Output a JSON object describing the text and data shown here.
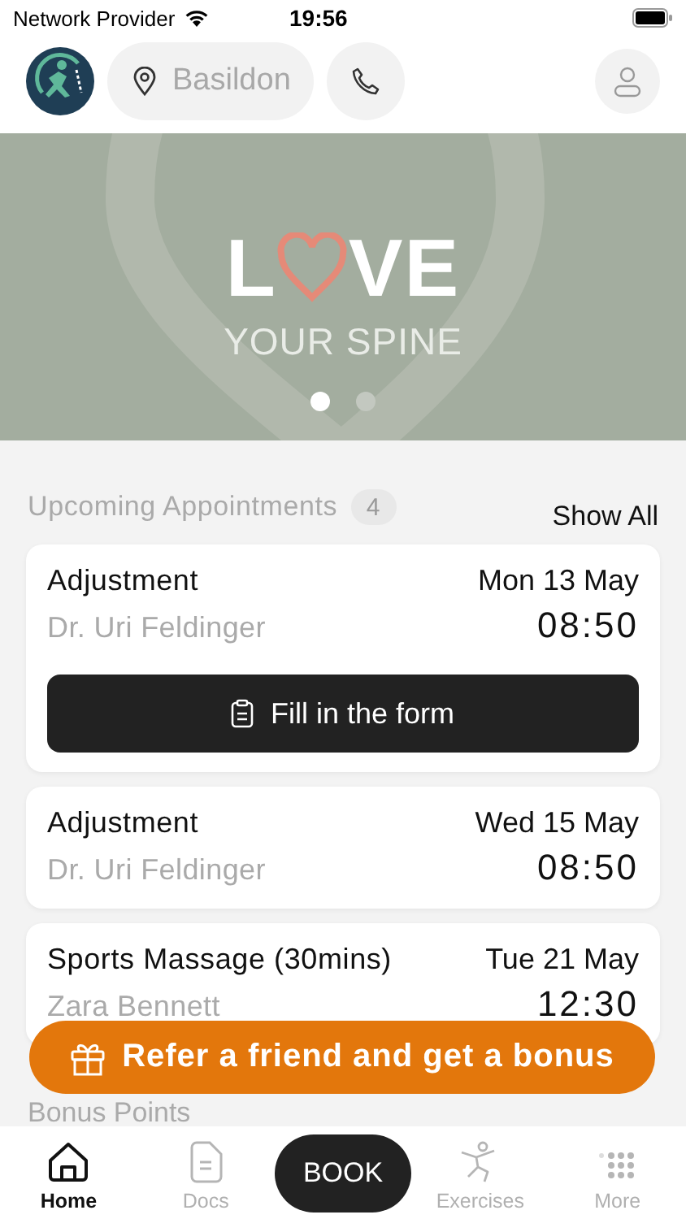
{
  "status_bar": {
    "carrier": "Network Provider",
    "time": "19:56"
  },
  "header": {
    "location": "Basildon"
  },
  "banner": {
    "title_start": "L",
    "title_end": "VE",
    "subtitle": "YOUR SPINE",
    "slides": [
      {
        "selected": true
      },
      {
        "selected": false
      }
    ]
  },
  "appointments": {
    "title": "Upcoming Appointments",
    "count": "4",
    "show_all": "Show All",
    "items": [
      {
        "service": "Adjustment",
        "practitioner": "Dr. Uri Feldinger",
        "date": "Mon 13 May",
        "time": "08:50",
        "action": "Fill in the form"
      },
      {
        "service": "Adjustment",
        "practitioner": "Dr. Uri Feldinger",
        "date": "Wed 15 May",
        "time": "08:50"
      },
      {
        "service": "Sports Massage (30mins)",
        "practitioner": "Zara Bennett",
        "date": "Tue 21 May",
        "time": "12:30"
      }
    ]
  },
  "bonus": {
    "title": "Bonus Points"
  },
  "refer_button": "Refer a friend and get a bonus",
  "tabs": [
    {
      "kind": "home",
      "label": "Home",
      "selected": true
    },
    {
      "kind": "docs",
      "label": "Docs",
      "selected": false
    },
    {
      "kind": "book",
      "label": "BOOK",
      "selected": false
    },
    {
      "kind": "exercises",
      "label": "Exercises",
      "selected": false
    },
    {
      "kind": "more",
      "label": "More",
      "selected": false
    }
  ]
}
